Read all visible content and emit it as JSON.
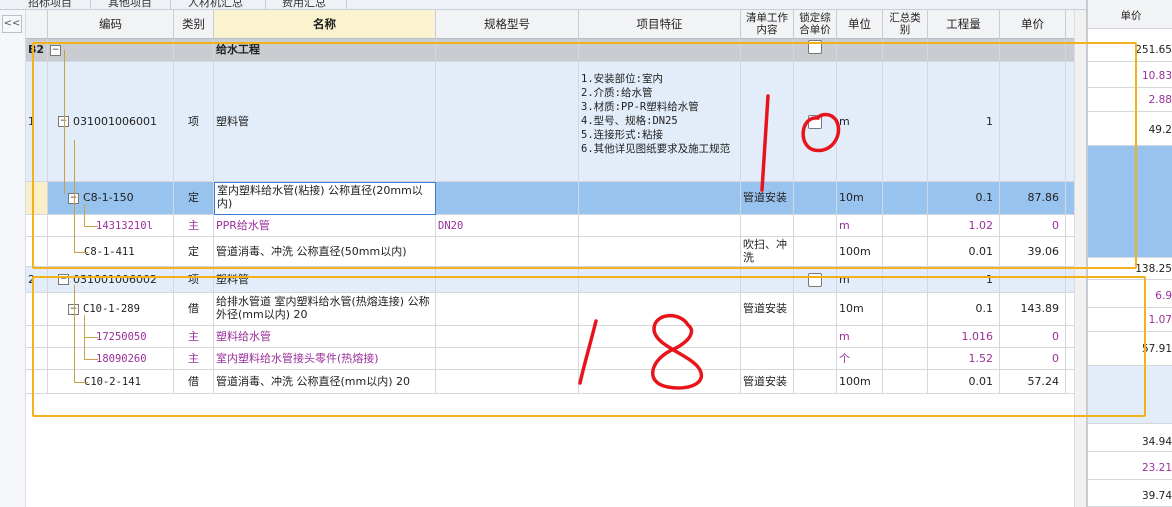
{
  "tabs": [
    "招标项目",
    "其他项目",
    "人材机汇总",
    "费用汇总"
  ],
  "collapse_icon_label": "<<",
  "header": {
    "code": "编码",
    "category": "类别",
    "name": "名称",
    "spec": "规格型号",
    "feature": "项目特征",
    "work_content": "清单工作内容",
    "lock_price": "锁定综合单价",
    "unit": "单位",
    "summary_cat": "汇总类别",
    "quantity": "工程量",
    "unit_price": "单价"
  },
  "rows": [
    {
      "type": "section",
      "seq": "B2",
      "code": "",
      "cat": "",
      "name": "给水工程",
      "spec": "",
      "feature": "",
      "work": "",
      "lock": "checkbox",
      "unit": "",
      "qty": "",
      "price": ""
    },
    {
      "type": "item",
      "seq": "1",
      "code": "031001006001",
      "cat": "项",
      "name": "塑料管",
      "spec": "",
      "feature": [
        "1.安装部位:室内",
        "2.介质:给水管",
        "3.材质:PP-R塑料给水管",
        "4.型号、规格:DN25",
        "5.连接形式:粘接",
        "6.其他详见图纸要求及施工规范"
      ],
      "work": "",
      "lock": "checkbox",
      "unit": "m",
      "qty": "1",
      "price": ""
    },
    {
      "type": "quota-selected",
      "seq": "",
      "code": "C8-1-150",
      "cat": "定",
      "name": "室内塑料给水管(粘接) 公称直径(20mm以内)",
      "spec": "",
      "feature": "",
      "work": "管道安装",
      "unit": "10m",
      "qty": "0.1",
      "price": "87.86"
    },
    {
      "type": "material",
      "seq": "",
      "code": "14313210l",
      "cat": "主",
      "name": "PPR给水管",
      "spec": "DN20",
      "feature": "",
      "work": "",
      "unit": "m",
      "qty": "1.02",
      "price": "0"
    },
    {
      "type": "quota",
      "seq": "",
      "code": "C8-1-411",
      "cat": "定",
      "name": "管道消毒、冲洗 公称直径(50mm以内)",
      "spec": "",
      "feature": "",
      "work": "吹扫、冲洗",
      "unit": "100m",
      "qty": "0.01",
      "price": "39.06"
    },
    {
      "type": "item",
      "seq": "2",
      "code": "031001006002",
      "cat": "项",
      "name": "塑料管",
      "spec": "",
      "feature": "",
      "work": "",
      "lock": "checkbox",
      "unit": "m",
      "qty": "1",
      "price": ""
    },
    {
      "type": "quota",
      "seq": "",
      "code": "C10-1-289",
      "cat": "借",
      "name": "给排水管道 室内塑料给水管(热熔连接) 公称外径(mm以内) 20",
      "spec": "",
      "feature": "",
      "work": "管道安装",
      "unit": "10m",
      "qty": "0.1",
      "price": "143.89"
    },
    {
      "type": "material",
      "seq": "",
      "code": "17250050",
      "cat": "主",
      "name": "塑料给水管",
      "spec": "",
      "feature": "",
      "work": "",
      "unit": "m",
      "qty": "1.016",
      "price": "0"
    },
    {
      "type": "material",
      "seq": "",
      "code": "18090260",
      "cat": "主",
      "name": "室内塑料给水管接头零件(热熔接)",
      "spec": "",
      "feature": "",
      "work": "",
      "unit": "个",
      "qty": "1.52",
      "price": "0"
    },
    {
      "type": "quota",
      "seq": "",
      "code": "C10-2-141",
      "cat": "借",
      "name": "管道消毒、冲洗 公称直径(mm以内) 20",
      "spec": "",
      "feature": "",
      "work": "管道安装",
      "unit": "100m",
      "qty": "0.01",
      "price": "57.24"
    }
  ],
  "right_panel": {
    "header": "单价",
    "values": [
      "251.65",
      "10.83",
      "2.88",
      "49.2",
      "",
      "138.25",
      "6.9",
      "1.07",
      "57.91",
      "",
      "34.94",
      "23.21",
      "39.74"
    ]
  },
  "annotations": {
    "upper_number": "10",
    "lower_number": "18",
    "box_color": "#f3b21d",
    "ink_color": "#e8141b"
  }
}
